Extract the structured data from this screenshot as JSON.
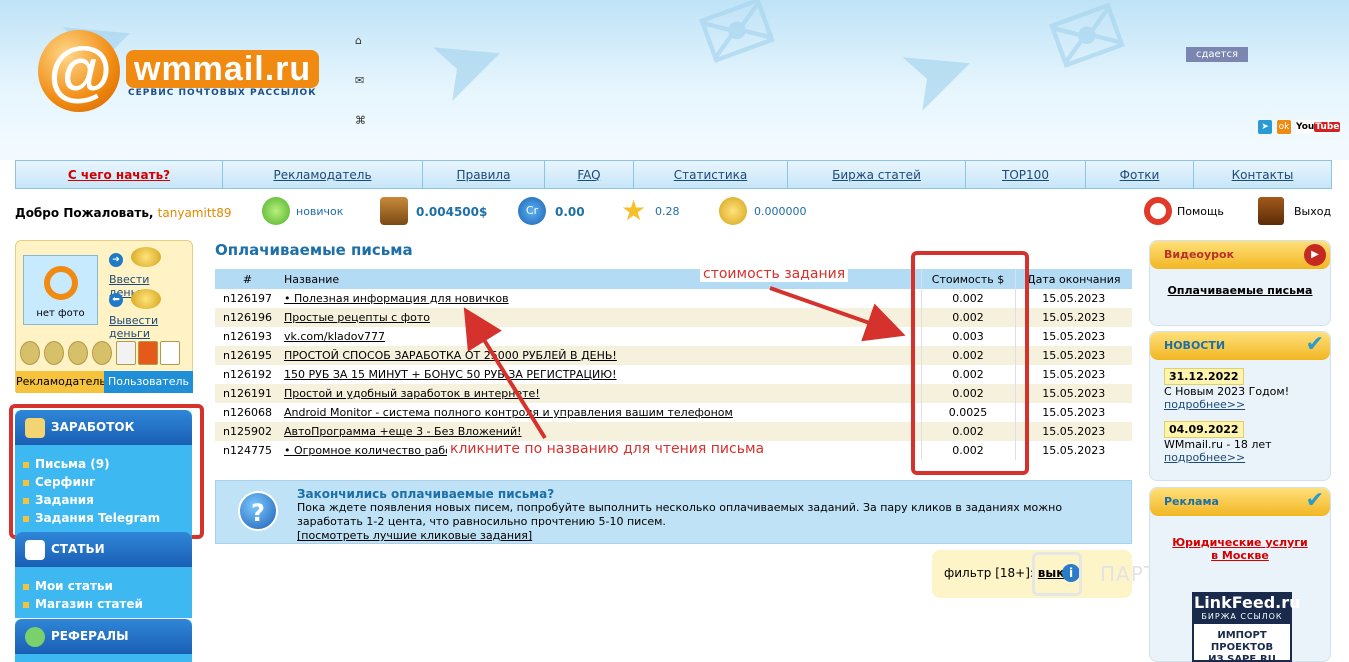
{
  "header": {
    "logo_text": "wmmail.ru",
    "logo_subtitle": "СЕРВИС ПОЧТОВЫХ РАССЫЛОК",
    "ad_badge": "сдается",
    "social": [
      "youtube-logo"
    ]
  },
  "nav": [
    "С чего начать?",
    "Рекламодатель",
    "Правила",
    "FAQ",
    "Статистика",
    "Биржа статей",
    "TOP100",
    "Фотки",
    "Контакты"
  ],
  "status": {
    "welcome": "Добро Пожаловать,",
    "username": "tanyamitt89",
    "level": "новичок",
    "balance": "0.004500$",
    "credits": "0.00",
    "rating": "0.28",
    "coins": "0.000000",
    "help": "Помощь",
    "logout": "Выход"
  },
  "profile": {
    "no_photo": "нет фото",
    "deposit": "Ввести деньги",
    "withdraw": "Вывести деньги",
    "tab_advertiser": "Рекламодатель",
    "tab_user": "Пользователь"
  },
  "sidebar": {
    "earn_title": "ЗАРАБОТОК",
    "earn_items": [
      "Письма (9)",
      "Серфинг",
      "Задания",
      "Задания Telegram"
    ],
    "articles_title": "СТАТЬИ",
    "articles_items": [
      "Мои статьи",
      "Магазин статей"
    ],
    "referrals_title": "РЕФЕРАЛЫ"
  },
  "main": {
    "title": "Оплачиваемые письма",
    "columns": {
      "id": "#",
      "name": "Название",
      "price": "Стоимость $",
      "date": "Дата окончания"
    },
    "rows": [
      {
        "id": "n126197",
        "name": "• Полезная информация для новичков",
        "price": "0.002",
        "date": "15.05.2023"
      },
      {
        "id": "n126196",
        "name": "Простые рецепты с фото",
        "price": "0.002",
        "date": "15.05.2023"
      },
      {
        "id": "n126193",
        "name": "vk.com/kladov777",
        "price": "0.003",
        "date": "15.05.2023"
      },
      {
        "id": "n126195",
        "name": "ПРОСТОЙ СПОСОБ ЗАРАБОТКА ОТ 25000 РУБЛЕЙ В ДЕНЬ!",
        "price": "0.002",
        "date": "15.05.2023"
      },
      {
        "id": "n126192",
        "name": "150 РУБ ЗА 15 МИНУТ + БОНУС 50 РУБ ЗА РЕГИСТРАЦИЮ!",
        "price": "0.002",
        "date": "15.05.2023"
      },
      {
        "id": "n126191",
        "name": "Простой и удобный заработок в интернете!",
        "price": "0.002",
        "date": "15.05.2023"
      },
      {
        "id": "n126068",
        "name": "Android Monitor - система полного контроля и управления вашим телефоном",
        "price": "0.0025",
        "date": "15.05.2023"
      },
      {
        "id": "n125902",
        "name": "АвтоПрограмма +еще 3 - Без Вложений!",
        "price": "0.002",
        "date": "15.05.2023"
      },
      {
        "id": "n124775",
        "name": "• Огромное количество работы",
        "price": "0.002",
        "date": "15.05.2023"
      }
    ],
    "annotation_price": "стоимость задания",
    "annotation_click": "кликните по названию для чтения письма",
    "info_title": "Закончились оплачиваемые письма?",
    "info_text": "Пока ждете появления новых писем, попробуйте выполнить несколько оплачиваемых заданий. За пару кликов в заданиях можно заработать 1-2 цента, что равносильно прочтению 5-10 писем.",
    "info_link": "[посмотреть лучшие кликовые задания]",
    "filter_label": "фильтр [18+]:",
    "filter_value": "выкл",
    "watermark": "ПАРТНЕРКИН"
  },
  "right": {
    "video_title": "Видеоурок",
    "video_link": "Оплачиваемые письма",
    "news_title": "НОВОСТИ",
    "news": [
      {
        "date": "31.12.2022",
        "text": "С Новым 2023 Годом!",
        "more": "подробнее>>"
      },
      {
        "date": "04.09.2022",
        "text": "WMmail.ru - 18 лет",
        "more": "подробнее>>"
      }
    ],
    "ads_title": "Реклама",
    "ads_link": "Юридические услуги в Москве",
    "linkfeed_name": "LinkFeed.ru",
    "linkfeed_sub": "БИРЖА ССЫЛОК",
    "linkfeed_body_1": "ИМПОРТ",
    "linkfeed_body_2": "ПРОЕКТОВ",
    "linkfeed_body_3": "ИЗ SAPE.RU"
  },
  "colors": {
    "accent": "#1d6fa8",
    "annotation": "#d6322d",
    "nav_text": "#1d4a7a",
    "highlight": "#d40000"
  }
}
